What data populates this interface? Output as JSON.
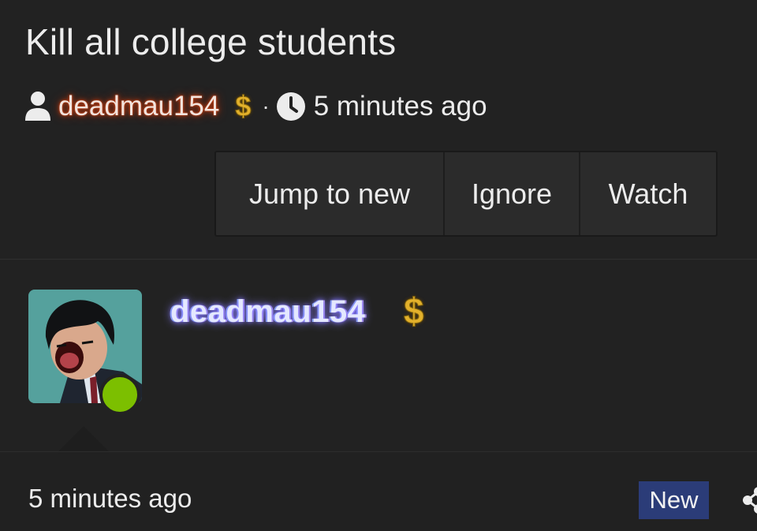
{
  "thread": {
    "title": "Kill all college students",
    "author": "deadmau154",
    "author_badge_icon": "dollar-sign-icon",
    "author_badge_symbol": "$",
    "separator": "·",
    "time_ago": "5 minutes ago"
  },
  "actions": {
    "jump_label": "Jump to new",
    "ignore_label": "Ignore",
    "watch_label": "Watch"
  },
  "post": {
    "username": "deadmau154",
    "badge_symbol": "$",
    "status": "online",
    "time_ago": "5 minutes ago",
    "new_badge": "New"
  },
  "colors": {
    "background": "#212121",
    "online": "#7cbf00",
    "new_badge": "#2b3c78",
    "badge_gold": "#e3b12b",
    "author_glow": "#c43c10",
    "username_glow": "#7a6cff"
  }
}
